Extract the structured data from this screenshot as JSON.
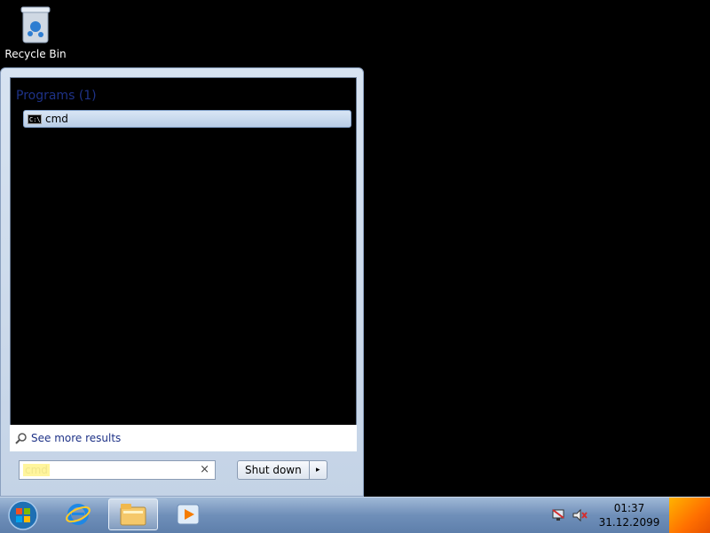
{
  "desktop": {
    "icons": [
      {
        "label": "Recycle Bin",
        "icon": "recycle-bin-icon"
      }
    ]
  },
  "start_menu": {
    "section_header": "Programs (1)",
    "results": [
      {
        "name": "cmd",
        "icon": "cmd-icon"
      }
    ],
    "see_more": "See more results",
    "search": {
      "query": "cmd",
      "clear": "×"
    },
    "shutdown_label": "Shut down",
    "shutdown_arrow": "▸"
  },
  "taskbar": {
    "pinned": [
      {
        "name": "start",
        "icon": "windows-orb-icon"
      },
      {
        "name": "internet-explorer",
        "icon": "internet-explorer-icon"
      },
      {
        "name": "explorer",
        "icon": "folder-icon"
      },
      {
        "name": "media-player",
        "icon": "media-player-icon"
      }
    ],
    "clock": {
      "time": "01:37",
      "date": "31.12.2099"
    },
    "tray_icons": [
      "network-disconnected-icon",
      "speaker-muted-icon"
    ]
  },
  "colors": {
    "desktop_bg": "#000000",
    "menu_bg": "#d7e3f1",
    "section_header": "#1e3287",
    "taskbar": "#6f8fb9"
  }
}
